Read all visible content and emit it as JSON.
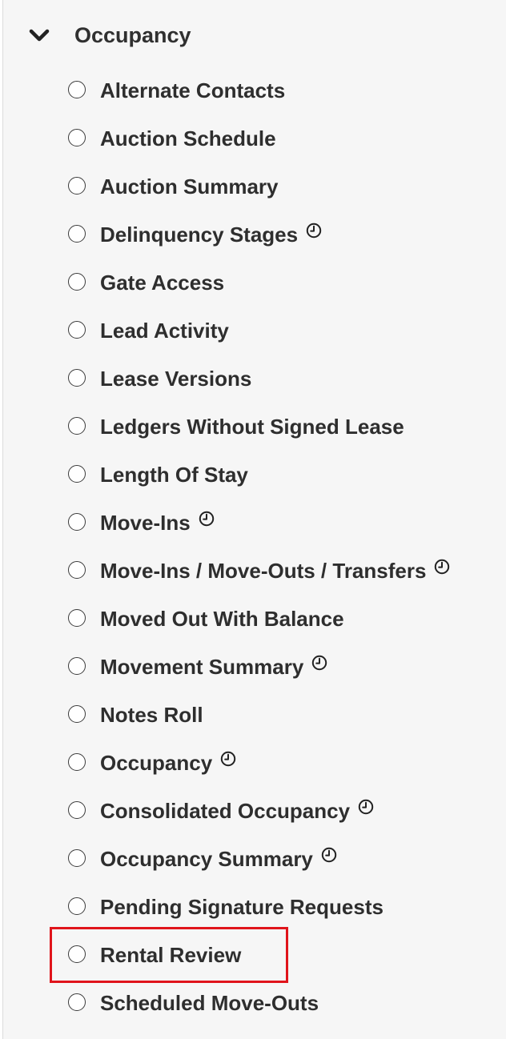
{
  "section": {
    "title": "Occupancy",
    "expand_icon": "chevron-down-icon",
    "expanded": true
  },
  "reports": [
    {
      "id": "alternate-contacts",
      "label": "Alternate Contacts",
      "scheduled": false
    },
    {
      "id": "auction-schedule",
      "label": "Auction Schedule",
      "scheduled": false
    },
    {
      "id": "auction-summary",
      "label": "Auction Summary",
      "scheduled": false
    },
    {
      "id": "delinquency-stages",
      "label": "Delinquency Stages",
      "scheduled": true
    },
    {
      "id": "gate-access",
      "label": "Gate Access",
      "scheduled": false
    },
    {
      "id": "lead-activity",
      "label": "Lead Activity",
      "scheduled": false
    },
    {
      "id": "lease-versions",
      "label": "Lease Versions",
      "scheduled": false
    },
    {
      "id": "ledgers-without-signed-lease",
      "label": "Ledgers Without Signed Lease",
      "scheduled": false
    },
    {
      "id": "length-of-stay",
      "label": "Length Of Stay",
      "scheduled": false
    },
    {
      "id": "move-ins",
      "label": "Move-Ins",
      "scheduled": true
    },
    {
      "id": "move-ins-move-outs-transfers",
      "label": "Move-Ins / Move-Outs / Transfers",
      "scheduled": true
    },
    {
      "id": "moved-out-with-balance",
      "label": "Moved Out With Balance",
      "scheduled": false
    },
    {
      "id": "movement-summary",
      "label": "Movement Summary",
      "scheduled": true
    },
    {
      "id": "notes-roll",
      "label": "Notes Roll",
      "scheduled": false
    },
    {
      "id": "occupancy",
      "label": "Occupancy",
      "scheduled": true
    },
    {
      "id": "consolidated-occupancy",
      "label": "Consolidated Occupancy",
      "scheduled": true
    },
    {
      "id": "occupancy-summary",
      "label": "Occupancy Summary",
      "scheduled": true
    },
    {
      "id": "pending-signature-requests",
      "label": "Pending Signature Requests",
      "scheduled": false
    },
    {
      "id": "rental-review",
      "label": "Rental Review",
      "scheduled": false,
      "highlighted": true
    },
    {
      "id": "scheduled-move-outs",
      "label": "Scheduled Move-Outs",
      "scheduled": false
    }
  ],
  "icons": {
    "radio": "radio-unchecked-icon",
    "scheduled": "clock-icon"
  },
  "colors": {
    "panel_background": "#f6f6f6",
    "text": "#2e2e2e",
    "highlight": "#e0141b"
  },
  "selected_report": null
}
